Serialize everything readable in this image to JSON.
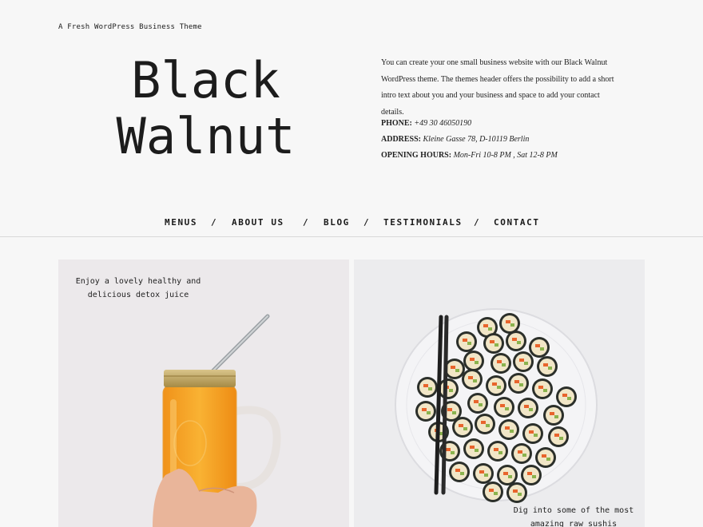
{
  "site": {
    "tagline": "A Fresh WordPress Business Theme",
    "title_line1": "Black",
    "title_line2": "Walnut"
  },
  "intro": {
    "text": "You can create your one small business website with our Black Walnut WordPress theme. The themes header offers the possibility to add a short intro text about you and your business and space to add your contact details."
  },
  "contact": {
    "phone_label": "PHONE:",
    "phone_value": "+49 30 46050190",
    "address_label": "ADDRESS:",
    "address_value": "Kleine Gasse 78, D-10119 Berlin",
    "hours_label": "OPENING HOURS:",
    "hours_value": "Mon-Fri 10-8 PM , Sat 12-8 PM"
  },
  "nav": {
    "items": [
      "MENUS",
      "ABOUT US",
      "BLOG",
      "TESTIMONIALS",
      "CONTACT"
    ],
    "separator": "/"
  },
  "cards": [
    {
      "caption_line1": "Enjoy a lovely healthy and",
      "caption_line2": "delicious detox juice",
      "image": "juice-jar-photo"
    },
    {
      "caption_line1": "Dig into some of the most",
      "caption_line2": "amazing raw sushis",
      "image": "sushi-plate-photo"
    }
  ],
  "colors": {
    "background": "#f7f7f7",
    "text": "#1a1a1a",
    "juice": "#f5a623",
    "card_bg": "#ece9eb"
  }
}
